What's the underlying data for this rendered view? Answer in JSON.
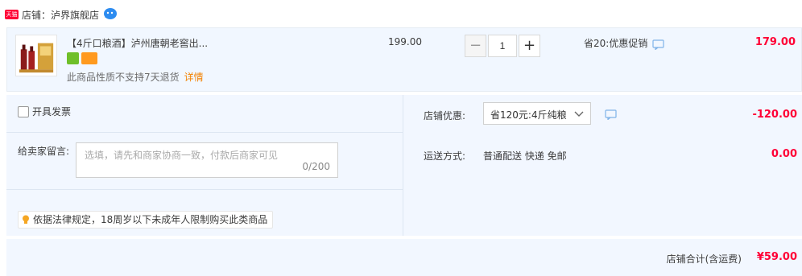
{
  "store": {
    "badge": "天猫",
    "label": "店铺：泸界旗舰店"
  },
  "item": {
    "title": "【4斤口粮酒】泸州唐朝老窖出...",
    "policy": "此商品性质不支持7天退货",
    "detail_link": "详情",
    "unit_price": "199.00",
    "quantity": "1",
    "minus_label": "−",
    "plus_label": "+",
    "promotion": "省20:优惠促销",
    "total": "179.00"
  },
  "extras": {
    "invoice_label": "开具发票",
    "message_label": "给卖家留言:",
    "message_placeholder": "选填，请先和商家协商一致，付款后商家可见",
    "message_counter": "0/200",
    "law_note": "依据法律规定，18周岁以下未成年人限制购买此类商品",
    "discount_label": "店铺优惠:",
    "discount_selected": "省120元:4斤纯粮",
    "discount_amount": "-120.00",
    "shipping_label": "运送方式:",
    "shipping_value": "普通配送 快递 免邮",
    "shipping_amount": "0.00"
  },
  "summary": {
    "label": "店铺合计(含运费)",
    "total": "¥59.00"
  },
  "colors": {
    "accent_red": "#ff0036",
    "panel_bg": "#f2f7ff",
    "link_orange": "#f28100",
    "chat_blue": "#2d8cf0"
  }
}
